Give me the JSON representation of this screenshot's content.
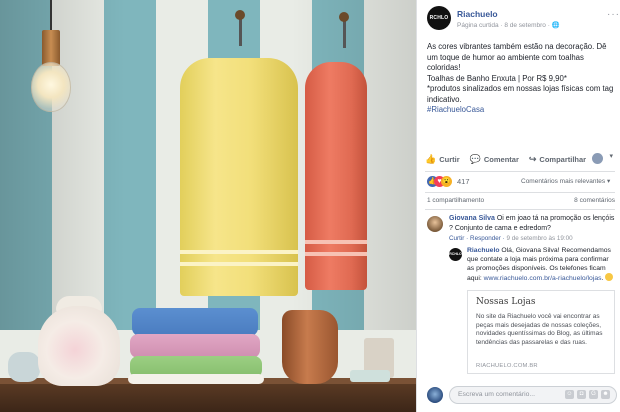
{
  "post": {
    "page_name": "Riachuelo",
    "logo_text": "RCHLO",
    "meta": "Página curtida · 8 de setembro · ",
    "more_label": "···",
    "body_lines": [
      "As cores vibrantes também estão na decoração. Dê um toque de humor ao ambiente com toalhas coloridas!",
      "Toalhas de Banho Enxuta | Por R$ 9,90*",
      "*produtos sinalizados em nossas lojas físicas com tag indicativo."
    ],
    "hashtag": "#RiachueloCasa"
  },
  "actions": {
    "like_label": "Curtir",
    "comment_label": "Comentar",
    "share_label": "Compartilhar",
    "caret": "▾"
  },
  "reactions": {
    "count": "417",
    "sort_label": "Comentários mais relevantes ▾"
  },
  "stats": {
    "shares": "1 compartilhamento",
    "comments": "8 comentários"
  },
  "comments": [
    {
      "name": "Giovana Silva",
      "text": " Oi em joao tá na promoção os lençóis ? Conjunto de cama e edredom?",
      "like": "Curtir",
      "reply": "Responder",
      "time": "9 de setembro às 19:00"
    }
  ],
  "reply": {
    "name": "Riachuelo",
    "logo_text": "RCHLO",
    "text": " Olá, Giovana Silva! Recomendamos que contate a loja mais próxima para confirmar as promoções disponíveis. Os telefones ficam aqui: ",
    "link": "www.riachuelo.com.br/a-riachuelo/lojas"
  },
  "link_card": {
    "title": "Nossas Lojas",
    "description": "No site da Riachuelo você vai encontrar as peças mais desejadas de nossas coleções, novidades quentíssimas do Blog, as últimas tendências das passarelas e das ruas.",
    "url": "RIACHUELO.COM.BR"
  },
  "write_comment": {
    "placeholder": "Escreva um comentário..."
  }
}
